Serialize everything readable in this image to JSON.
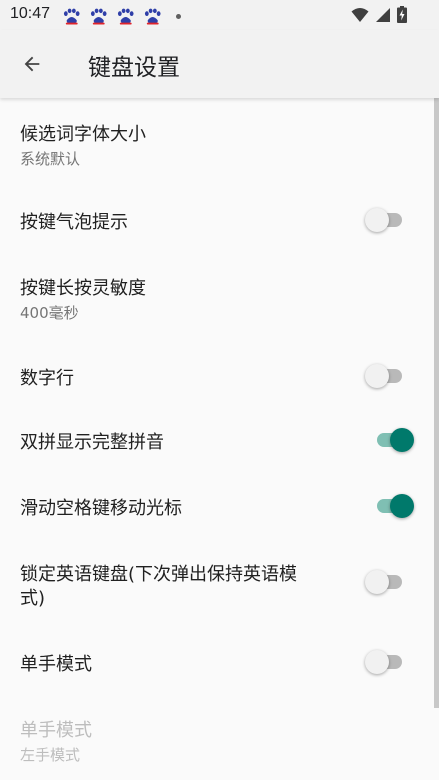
{
  "status_bar": {
    "time": "10:47",
    "notification_icons": [
      "baidu-paw-icon",
      "baidu-paw-icon",
      "baidu-paw-icon",
      "baidu-paw-icon"
    ],
    "system_icons": [
      "wifi-icon",
      "signal-icon",
      "battery-charging-icon"
    ]
  },
  "app_bar": {
    "back_icon": "arrow-left-icon",
    "title": "键盘设置"
  },
  "settings": {
    "candidate_font_size": {
      "title": "候选词字体大小",
      "summary": "系统默认"
    },
    "key_popup_hint": {
      "title": "按键气泡提示",
      "checked": false
    },
    "long_press_sensitivity": {
      "title": "按键长按灵敏度",
      "summary": "400毫秒"
    },
    "number_row": {
      "title": "数字行",
      "checked": false
    },
    "double_pinyin_full": {
      "title": "双拼显示完整拼音",
      "checked": true
    },
    "space_cursor_move": {
      "title": "滑动空格键移动光标",
      "checked": true
    },
    "lock_english_keyboard": {
      "title": "锁定英语键盘(下次弹出保持英语模",
      "title_line2": "式)",
      "checked": false
    },
    "one_hand_mode": {
      "title": "单手模式",
      "checked": false
    },
    "one_hand_side": {
      "title": "单手模式",
      "summary": "左手模式",
      "enabled": false
    }
  },
  "colors": {
    "accent": "#00796b",
    "accent_track": "#7fbfb3",
    "switch_off_track": "#b9b9b9",
    "switch_off_thumb": "#f1f1f1",
    "background": "#fafafa",
    "app_bar": "#f2f2f2"
  }
}
